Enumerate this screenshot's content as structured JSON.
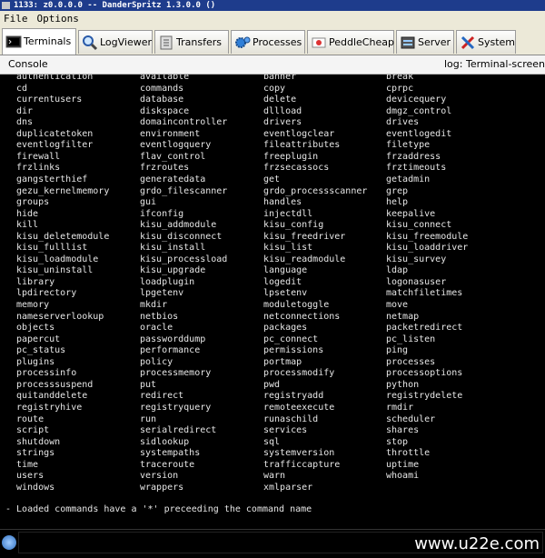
{
  "window": {
    "title": "1133: z0.0.0.0 -- DanderSpritz 1.3.0.0 ()"
  },
  "menu": {
    "file": "File",
    "options": "Options"
  },
  "tabs": [
    {
      "label": "Terminals",
      "icon": "terminal-icon",
      "active": true
    },
    {
      "label": "LogViewer",
      "icon": "magnifier-icon",
      "active": false
    },
    {
      "label": "Transfers",
      "icon": "transfer-icon",
      "active": false
    },
    {
      "label": "Processes",
      "icon": "gears-icon",
      "active": false
    },
    {
      "label": "PeddleCheap",
      "icon": "peddlecheap-icon",
      "active": false
    },
    {
      "label": "Server",
      "icon": "server-icon",
      "active": false
    },
    {
      "label": "System",
      "icon": "tools-icon",
      "active": false
    }
  ],
  "console": {
    "label": "Console",
    "log": "log: Terminal-screen"
  },
  "commands": [
    [
      "authentication",
      "available",
      "banner",
      "break"
    ],
    [
      "cd",
      "commands",
      "copy",
      "cprpc"
    ],
    [
      "currentusers",
      "database",
      "delete",
      "devicequery"
    ],
    [
      "dir",
      "diskspace",
      "dllload",
      "dmgz_control"
    ],
    [
      "dns",
      "domaincontroller",
      "drivers",
      "drives"
    ],
    [
      "duplicatetoken",
      "environment",
      "eventlogclear",
      "eventlogedit"
    ],
    [
      "eventlogfilter",
      "eventlogquery",
      "fileattributes",
      "filetype"
    ],
    [
      "firewall",
      "flav_control",
      "freeplugin",
      "frzaddress"
    ],
    [
      "frzlinks",
      "frzroutes",
      "frzsecassocs",
      "frztimeouts"
    ],
    [
      "gangsterthief",
      "generatedata",
      "get",
      "getadmin"
    ],
    [
      "gezu_kernelmemory",
      "grdo_filescanner",
      "grdo_processscanner",
      "grep"
    ],
    [
      "groups",
      "gui",
      "handles",
      "help"
    ],
    [
      "hide",
      "ifconfig",
      "injectdll",
      "keepalive"
    ],
    [
      "kill",
      "kisu_addmodule",
      "kisu_config",
      "kisu_connect"
    ],
    [
      "kisu_deletemodule",
      "kisu_disconnect",
      "kisu_freedriver",
      "kisu_freemodule"
    ],
    [
      "kisu_fulllist",
      "kisu_install",
      "kisu_list",
      "kisu_loaddriver"
    ],
    [
      "kisu_loadmodule",
      "kisu_processload",
      "kisu_readmodule",
      "kisu_survey"
    ],
    [
      "kisu_uninstall",
      "kisu_upgrade",
      "language",
      "ldap"
    ],
    [
      "library",
      "loadplugin",
      "logedit",
      "logonasuser"
    ],
    [
      "lpdirectory",
      "lpgetenv",
      "lpsetenv",
      "matchfiletimes"
    ],
    [
      "memory",
      "mkdir",
      "moduletoggle",
      "move"
    ],
    [
      "nameserverlookup",
      "netbios",
      "netconnections",
      "netmap"
    ],
    [
      "objects",
      "oracle",
      "packages",
      "packetredirect"
    ],
    [
      "papercut",
      "passworddump",
      "pc_connect",
      "pc_listen"
    ],
    [
      "pc_status",
      "performance",
      "permissions",
      "ping"
    ],
    [
      "plugins",
      "policy",
      "portmap",
      "processes"
    ],
    [
      "processinfo",
      "processmemory",
      "processmodify",
      "processoptions"
    ],
    [
      "processsuspend",
      "put",
      "pwd",
      "python"
    ],
    [
      "quitanddelete",
      "redirect",
      "registryadd",
      "registrydelete"
    ],
    [
      "registryhive",
      "registryquery",
      "remoteexecute",
      "rmdir"
    ],
    [
      "route",
      "run",
      "runaschild",
      "scheduler"
    ],
    [
      "script",
      "serialredirect",
      "services",
      "shares"
    ],
    [
      "shutdown",
      "sidlookup",
      "sql",
      "stop"
    ],
    [
      "strings",
      "systempaths",
      "systemversion",
      "throttle"
    ],
    [
      "time",
      "traceroute",
      "trafficcapture",
      "uptime"
    ],
    [
      "users",
      "version",
      "warn",
      "whoami"
    ],
    [
      "windows",
      "wrappers",
      "xmlparser",
      ""
    ]
  ],
  "message": "- Loaded commands have a '*' preceeding the command name",
  "input": {
    "value": ""
  },
  "watermark": "www.u22e.com",
  "colors": {
    "titlebar": "#1e3c8c",
    "terminal_bg": "#000000",
    "terminal_text": "#e6e6e6"
  }
}
